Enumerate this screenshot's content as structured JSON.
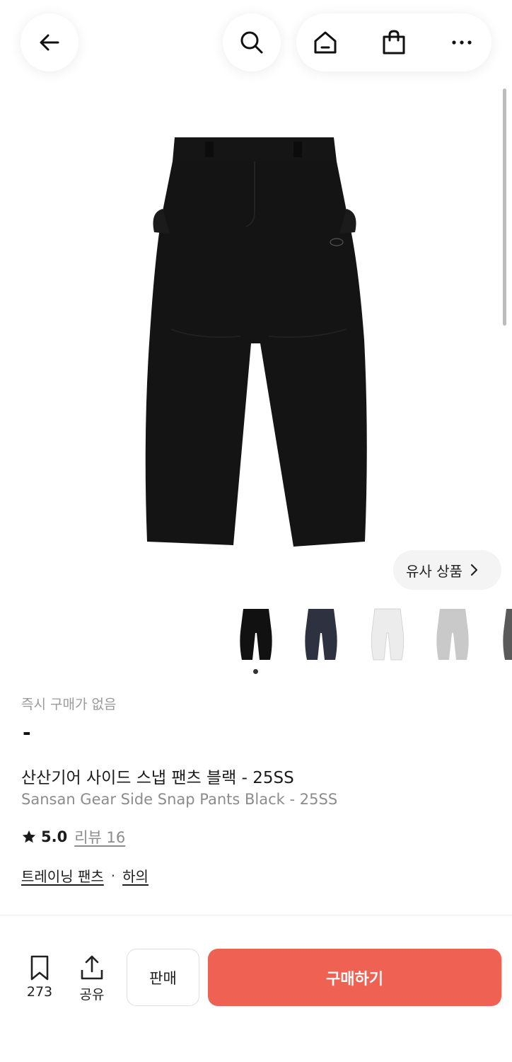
{
  "colors": {
    "accent": "#ef6253",
    "product_black": "#111111",
    "thumb_navy": "#2e3140",
    "thumb_white": "#e8e8e8",
    "thumb_gray": "#c8c8c8",
    "thumb_charcoal": "#5a5a5a"
  },
  "header": {
    "icons": [
      "back-arrow-icon",
      "search-icon",
      "home-icon",
      "shopping-bag-icon",
      "more-icon"
    ]
  },
  "gallery": {
    "similar_label": "유사 상품",
    "thumbnails": [
      "black",
      "navy",
      "white",
      "gray",
      "charcoal"
    ],
    "selected_index": 0
  },
  "product": {
    "instant_status": "즉시 구매가 없음",
    "price": "-",
    "name_ko": "산산기어 사이드 스냅 팬츠 블랙 - 25SS",
    "name_en": "Sansan Gear Side Snap Pants Black - 25SS",
    "rating": "5.0",
    "review_label": "리뷰 16",
    "category": "트레이닝 팬츠",
    "subcategory": "하의",
    "category_sep": "·"
  },
  "bottom_bar": {
    "bookmark_count": "273",
    "share_label": "공유",
    "sell_label": "판매",
    "buy_label": "구매하기"
  }
}
